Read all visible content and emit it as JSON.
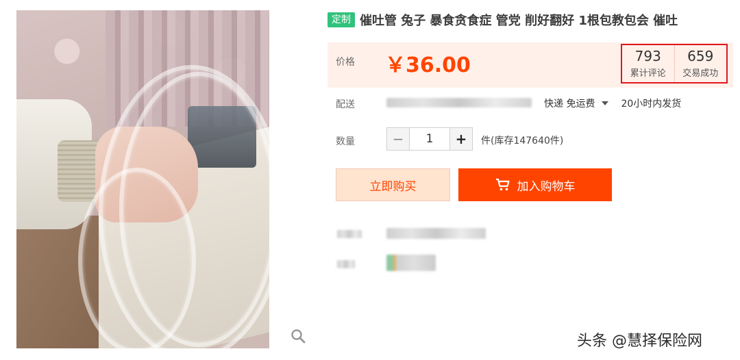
{
  "product": {
    "tag": "定制",
    "title": "催吐管 兔子 暴食贪食症 管党 削好翻好 1根包教包会 催吐"
  },
  "price": {
    "label": "价格",
    "value": "￥36.00"
  },
  "stats": {
    "reviews_count": "793",
    "reviews_label": "累计评论",
    "deals_count": "659",
    "deals_label": "交易成功"
  },
  "shipping": {
    "label": "配送",
    "method": "快递 免运费",
    "dispatch": "20小时内发货"
  },
  "quantity": {
    "label": "数量",
    "minus": "−",
    "value": "1",
    "plus": "+",
    "stock": "件(库存147640件)"
  },
  "actions": {
    "buy_now": "立即购买",
    "add_to_cart": "加入购物车"
  },
  "watermark": "头条 @慧择保险网",
  "colors": {
    "accent": "#ff4400",
    "price_bg": "#fff1ea",
    "tag_green": "#31c27c",
    "highlight_border": "#e0161b"
  },
  "icons": [
    "zoom-icon",
    "cart-icon",
    "caret-down-icon"
  ]
}
